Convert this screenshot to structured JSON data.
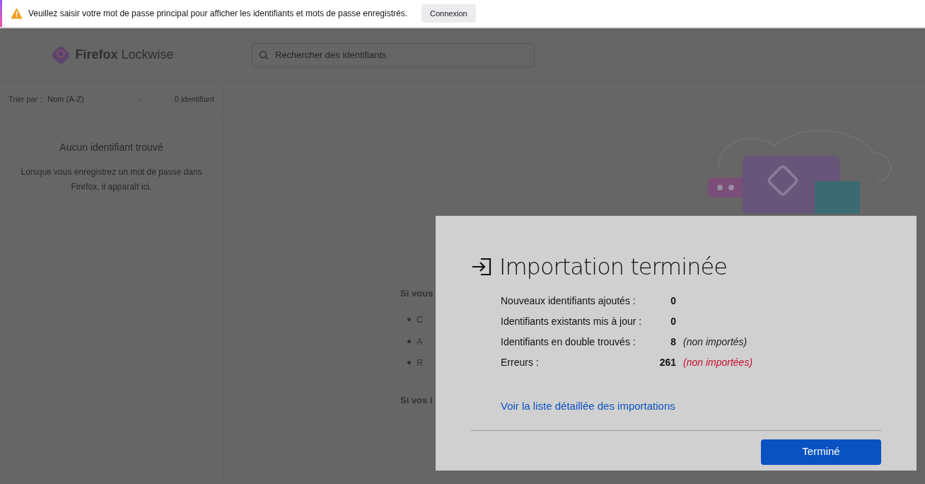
{
  "notification": {
    "message": "Veuillez saisir votre mot de passe principal pour afficher les identifiants et mots de passe enregistrés.",
    "button": "Connexion"
  },
  "header": {
    "logo_text_bold": "Firefox",
    "logo_text": "Lockwise",
    "search": {
      "placeholder": "Rechercher des identifiants"
    }
  },
  "sidebar": {
    "sort_label": "Trier par :",
    "sort_value": "Nom (A-Z)",
    "count": "0 identifiant",
    "empty_title": "Aucun identifiant trouvé",
    "empty_text": "Lorsque vous enregistrez un mot de passe dans Firefox, il apparaît ici."
  },
  "main": {
    "intro": "Si vous",
    "bullets": [
      "C",
      "A",
      "R"
    ],
    "outro": "Si vos i"
  },
  "dialog": {
    "title": "Importation terminée",
    "rows": [
      {
        "label": "Nouveaux identifiants ajoutés :",
        "value": "0"
      },
      {
        "label": "Identifiants existants mis à jour :",
        "value": "0"
      },
      {
        "label": "Identifiants en double trouvés :",
        "value": "8",
        "note": "(non importés)",
        "kind": "info"
      },
      {
        "label": "Erreurs :",
        "value": "261",
        "note": "(non importées)",
        "kind": "error"
      }
    ],
    "link": "Voir la liste détaillée des importations",
    "button": "Terminé"
  }
}
